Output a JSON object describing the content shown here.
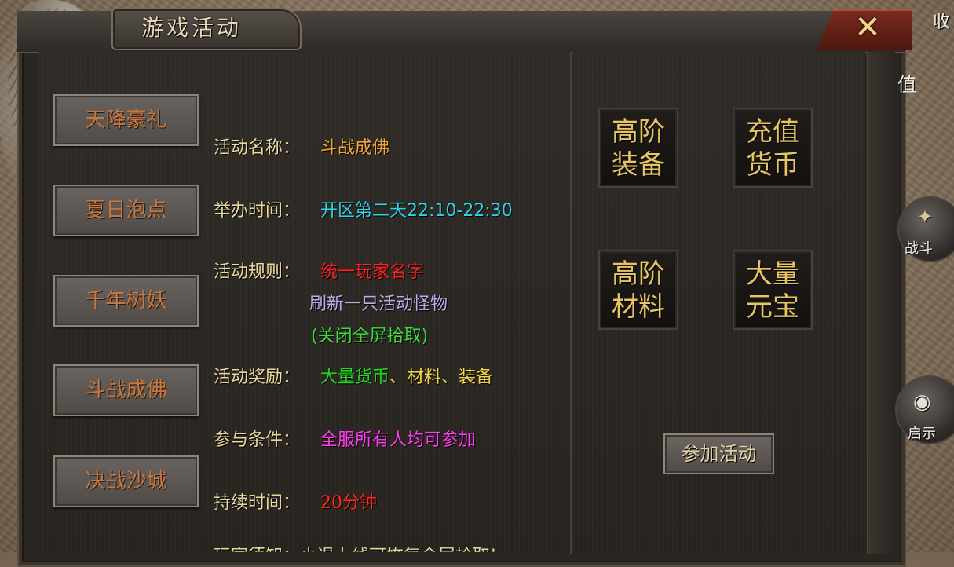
{
  "window": {
    "title": "游戏活动",
    "close_icon": "close-x-icon"
  },
  "activities": [
    {
      "label": "天降豪礼"
    },
    {
      "label": "夏日泡点"
    },
    {
      "label": "千年树妖"
    },
    {
      "label": "斗战成佛"
    },
    {
      "label": "决战沙城"
    }
  ],
  "info": {
    "name_label": "活动名称：",
    "name_value": "斗战成佛",
    "time_label": "举办时间：",
    "time_value": "开区第二天22:10-22:30",
    "rules_label": "活动规则：",
    "rules_line1": "统一玩家名字",
    "rules_line2": "刷新一只活动怪物",
    "rules_line3": "(关闭全屏拾取)",
    "reward_label": "活动奖励：",
    "reward_value_green": "大量货币",
    "reward_value_yellow": "、材料、装备",
    "cond_label": "参与条件：",
    "cond_value": "全服所有人均可参加",
    "duration_label": "持续时间：",
    "duration_value": "20分钟",
    "notice_partial": "玩家须知：小退上线可恢复全屏拾取!"
  },
  "rewards": [
    {
      "line1": "高阶",
      "line2": "装备"
    },
    {
      "line1": "充值",
      "line2": "货币"
    },
    {
      "line1": "高阶",
      "line2": "材料"
    },
    {
      "line1": "大量",
      "line2": "元宝"
    }
  ],
  "join_button": "参加活动",
  "side": {
    "top_partial": "收",
    "value_partial": "值",
    "battle": "战斗",
    "hint": "启示"
  },
  "colors": {
    "activity_text": "#c9773d",
    "label": "#e9d99d",
    "name_value": "#f0a43a",
    "time_value": "#2fd4e8",
    "rules_red": "#ff2020",
    "rules_lavender": "#b9aee8",
    "rules_green": "#3fdb3f",
    "reward_green": "#25d625",
    "reward_yellow": "#f2d54a",
    "cond_magenta": "#ff3df0",
    "duration_red": "#ff2a1a"
  }
}
